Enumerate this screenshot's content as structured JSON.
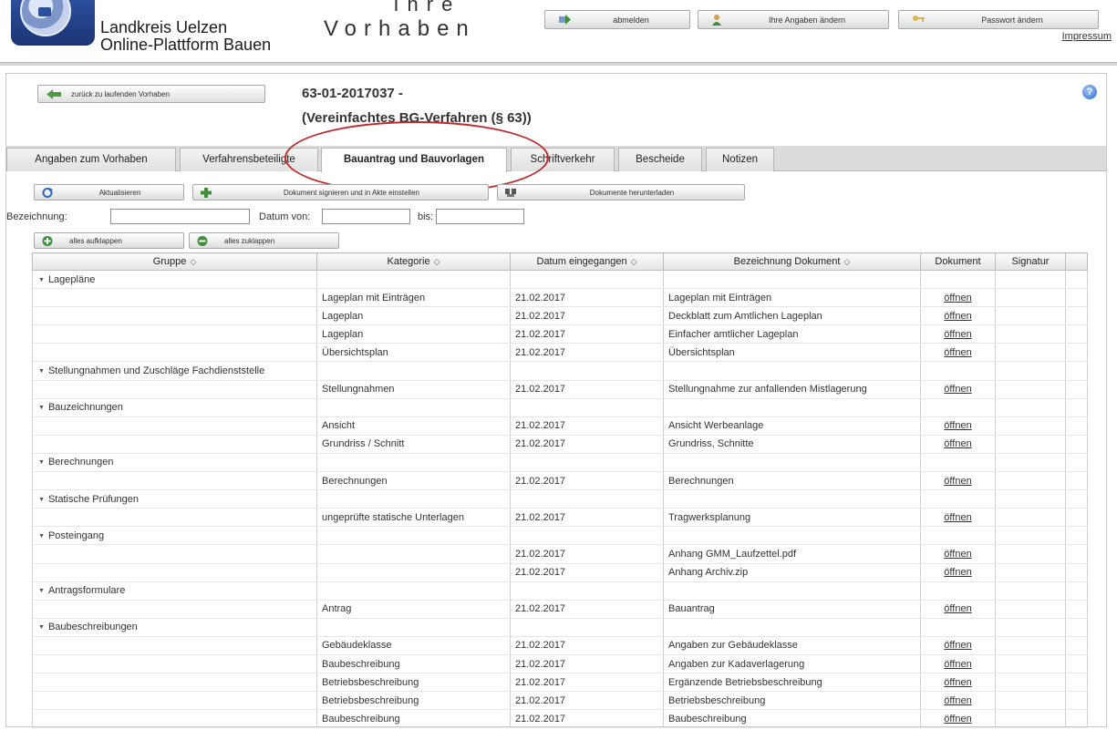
{
  "header": {
    "org_line1": "Landkreis Uelzen",
    "org_line2": "Online-Plattform Bauen",
    "title_top": "Ihre",
    "title_main": "Vorhaben",
    "logout_label": "abmelden",
    "edit_profile_label": "Ihre Angaben ändern",
    "change_password_label": "Passwort ändern",
    "impressum_label": "Impressum"
  },
  "project": {
    "back_label": "zurück zu laufenden Vorhaben",
    "id": "63-01-2017037 -",
    "type": "(Vereinfachtes BG-Verfahren (§ 63))",
    "help_icon": "?"
  },
  "tabs": [
    {
      "label": "Angaben zum Vorhaben"
    },
    {
      "label": "Verfahrensbeteiligte"
    },
    {
      "label": "Bauantrag und Bauvorlagen"
    },
    {
      "label": "Schriftverkehr"
    },
    {
      "label": "Bescheide"
    },
    {
      "label": "Notizen"
    }
  ],
  "toolbar": {
    "refresh_label": "Aktualisieren",
    "sign_label": "Dokument signieren und in Akte einstellen",
    "download_label": "Dokumente herunterladen",
    "expand_label": "alles aufklappen",
    "collapse_label": "alles zuklappen"
  },
  "filters": {
    "name_label": "Bezeichnung:",
    "name_value": "",
    "date_from_label": "Datum von:",
    "date_from_value": "",
    "date_to_label": "bis:",
    "date_to_value": ""
  },
  "table": {
    "columns": [
      "Gruppe",
      "Kategorie",
      "Datum eingegangen",
      "Bezeichnung Dokument",
      "Dokument",
      "Signatur"
    ],
    "open_label": "öffnen",
    "sort_icon": "◇",
    "groups": [
      {
        "name": "Lagepläne",
        "rows": [
          {
            "kategorie": "Lageplan mit Einträgen",
            "datum": "21.02.2017",
            "bezeichnung": "Lageplan mit Einträgen"
          },
          {
            "kategorie": "Lageplan",
            "datum": "21.02.2017",
            "bezeichnung": "Deckblatt zum Amtlichen Lageplan"
          },
          {
            "kategorie": "Lageplan",
            "datum": "21.02.2017",
            "bezeichnung": "Einfacher amtlicher Lageplan"
          },
          {
            "kategorie": "Übersichtsplan",
            "datum": "21.02.2017",
            "bezeichnung": "Übersichtsplan"
          }
        ]
      },
      {
        "name": "Stellungnahmen und Zuschläge Fachdienststelle",
        "rows": [
          {
            "kategorie": "Stellungnahmen",
            "datum": "21.02.2017",
            "bezeichnung": "Stellungnahme zur anfallenden Mistlagerung"
          }
        ]
      },
      {
        "name": "Bauzeichnungen",
        "rows": [
          {
            "kategorie": "Ansicht",
            "datum": "21.02.2017",
            "bezeichnung": "Ansicht Werbeanlage"
          },
          {
            "kategorie": "Grundriss / Schnitt",
            "datum": "21.02.2017",
            "bezeichnung": "Grundriss, Schnitte"
          }
        ]
      },
      {
        "name": "Berechnungen",
        "rows": [
          {
            "kategorie": "Berechnungen",
            "datum": "21.02.2017",
            "bezeichnung": "Berechnungen"
          }
        ]
      },
      {
        "name": "Statische Prüfungen",
        "rows": [
          {
            "kategorie": "ungeprüfte statische Unterlagen",
            "datum": "21.02.2017",
            "bezeichnung": "Tragwerksplanung"
          }
        ]
      },
      {
        "name": "Posteingang",
        "rows": [
          {
            "kategorie": "",
            "datum": "21.02.2017",
            "bezeichnung": "Anhang GMM_Laufzettel.pdf"
          },
          {
            "kategorie": "",
            "datum": "21.02.2017",
            "bezeichnung": "Anhang Archiv.zip"
          }
        ]
      },
      {
        "name": "Antragsformulare",
        "rows": [
          {
            "kategorie": "Antrag",
            "datum": "21.02.2017",
            "bezeichnung": "Bauantrag"
          }
        ]
      },
      {
        "name": "Baubeschreibungen",
        "rows": [
          {
            "kategorie": "Gebäudeklasse",
            "datum": "21.02.2017",
            "bezeichnung": "Angaben zur Gebäudeklasse"
          },
          {
            "kategorie": "Baubeschreibung",
            "datum": "21.02.2017",
            "bezeichnung": "Angaben zur Kadaverlagerung"
          },
          {
            "kategorie": "Betriebsbeschreibung",
            "datum": "21.02.2017",
            "bezeichnung": "Ergänzende Betriebsbeschreibung"
          },
          {
            "kategorie": "Betriebsbeschreibung",
            "datum": "21.02.2017",
            "bezeichnung": "Betriebsbeschreibung"
          },
          {
            "kategorie": "Baubeschreibung",
            "datum": "21.02.2017",
            "bezeichnung": "Baubeschreibung"
          }
        ]
      }
    ]
  }
}
